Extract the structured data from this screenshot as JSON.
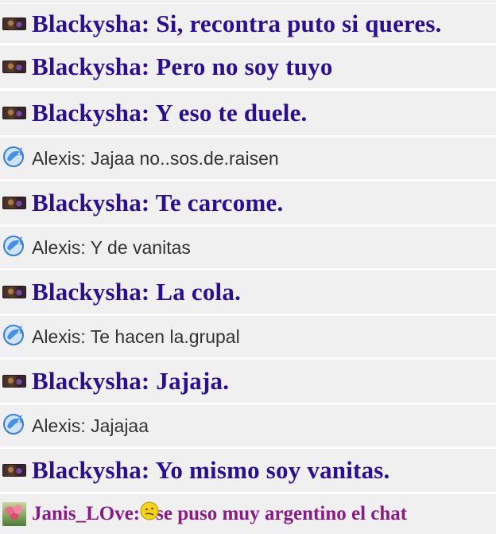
{
  "colors": {
    "row_bg": "#f0f0f0",
    "separator": "#ffffff",
    "blackysha_text": "#2c0f8f",
    "alexis_text": "#333333",
    "janis_text": "#8a1a86"
  },
  "messages": [
    {
      "user": "Blackysha",
      "avatar_icon": "blackysha-avatar-icon",
      "text": "Blackysha: Si, recontra puto si queres."
    },
    {
      "user": "Blackysha",
      "avatar_icon": "blackysha-avatar-icon",
      "text": "Blackysha: Pero no soy tuyo"
    },
    {
      "user": "Blackysha",
      "avatar_icon": "blackysha-avatar-icon",
      "text": "Blackysha: Y eso te duele."
    },
    {
      "user": "Alexis",
      "avatar_icon": "dolphin-avatar-icon",
      "text": "Alexis: Jajaa no..sos.de.raisen"
    },
    {
      "user": "Blackysha",
      "avatar_icon": "blackysha-avatar-icon",
      "text": "Blackysha: Te carcome."
    },
    {
      "user": "Alexis",
      "avatar_icon": "dolphin-avatar-icon",
      "text": "Alexis: Y de vanitas"
    },
    {
      "user": "Blackysha",
      "avatar_icon": "blackysha-avatar-icon",
      "text": "Blackysha: La cola."
    },
    {
      "user": "Alexis",
      "avatar_icon": "dolphin-avatar-icon",
      "text": "Alexis: Te hacen la.grupal"
    },
    {
      "user": "Blackysha",
      "avatar_icon": "blackysha-avatar-icon",
      "text": "Blackysha: Jajaja."
    },
    {
      "user": "Alexis",
      "avatar_icon": "dolphin-avatar-icon",
      "text": "Alexis: Jajajaa"
    },
    {
      "user": "Blackysha",
      "avatar_icon": "blackysha-avatar-icon",
      "text": "Blackysha: Yo mismo soy vanitas."
    },
    {
      "user": "Janis_LOve",
      "avatar_icon": "tulips-avatar-icon",
      "prefix": "Janis_LOve: ",
      "emoji_icon": "confused-smiley-icon",
      "text": "se puso muy argentino el chat"
    }
  ]
}
